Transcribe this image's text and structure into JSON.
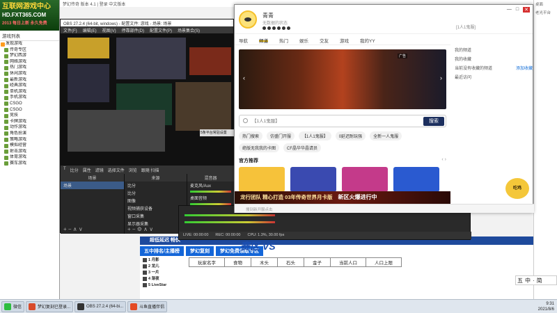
{
  "tree": {
    "logo_line1": "互联网游戏中心",
    "logo_line2": "HD.FXT365.COM",
    "logo_line3": "2013 每日上新 永久免费",
    "title": "游戏列表",
    "root": "发现游戏",
    "items": [
      "传奇专区",
      "梦幻西游",
      "网络游戏",
      "热门游戏",
      "休闲游戏",
      "最新游戏",
      "经典游戏",
      "单机游戏",
      "手机游戏",
      "CSGO",
      "CSGO",
      "竞技",
      "卡牌游戏",
      "动作游戏",
      "角色扮演",
      "策略游戏",
      "模拟经营",
      "射击游戏",
      "体育游戏",
      "赛车游戏"
    ]
  },
  "bg_window": {
    "title": "梦幻传奇 版本 4.1 | 登录 中文版本",
    "notice": "超低延迟 畅快",
    "tabs": [
      "五中排名/主播榜",
      "梦幻复刻",
      "梦幻免费领取专区"
    ],
    "table_headers": [
      "玩家名字",
      "食物",
      "木头",
      "石头",
      "金子",
      "当前人口",
      "人口上限"
    ],
    "ranks": [
      "1 月影",
      "2 龙儿",
      "3 一片",
      "4 渐夜",
      "5 LiveStar"
    ],
    "banner": "赛区 VS"
  },
  "obs": {
    "title": "OBS 27.2.4 (64-bit, windows) - 配置文件: 游戏 - 场景: 场景",
    "menu": [
      "文件(F)",
      "编辑(E)",
      "视图(V)",
      "停靠部件(D)",
      "配置文件(P)",
      "场景集合(S)",
      "工具(T)",
      "帮助(H)"
    ],
    "toolbar": [
      "T",
      "比分",
      "属性",
      "滤镜",
      "选择文件",
      "浏览",
      "跟随 扫描"
    ],
    "scenes_header": "场景",
    "scenes": [
      "场景"
    ],
    "sources_header": "来源",
    "sources": [
      "比分",
      "比分",
      "图像",
      "视频捕获设备",
      "窗口采集",
      "显示器采集"
    ],
    "mixer_header": "混音器",
    "mixer_labels": [
      "麦克风/Aux",
      "桌面音频"
    ],
    "status": [
      "LIVE: 00:00:00",
      "REC: 00:00:00",
      "CPU: 1.3%, 30.00 fps"
    ],
    "preview_caption": "5条平台常驻设置"
  },
  "yy": {
    "user_name": "青青",
    "signature": "无数据的状态",
    "channel_label": "[1人1鬼服]",
    "nav": [
      "导航",
      "频道",
      "热门",
      "娱乐",
      "交友",
      "游戏",
      "我的YY"
    ],
    "nav_active": 1,
    "carousel_ad": "广告",
    "search_placeholder": "【1人1鬼服】",
    "search_button": "搜索",
    "tags": [
      "热门搜索",
      "仿盛门开服",
      "【1人1鬼服】",
      "0延迟耐玩强",
      "全新一人鬼服",
      "绝版无我我的卡图",
      "CF晶华华晶请员"
    ],
    "rec_title": "官方推荐",
    "ad_text": "龙行团队 精心打造 03年传奇世界月卡版",
    "ad_cta": "新区火爆进行中",
    "status_text": "搜到新开服点击",
    "side_items": [
      {
        "label": "我的频道",
        "link": ""
      },
      {
        "label": "我的收藏",
        "link": ""
      },
      {
        "label": "当前没有收藏的频道",
        "link": "添加收藏"
      },
      {
        "label": "最近访问",
        "link": ""
      }
    ],
    "mascot": "吃鸡"
  },
  "wubi": [
    "五",
    "中",
    "·",
    "简"
  ],
  "right_strip": [
    "桌面",
    "老光平台"
  ],
  "taskbar": {
    "items": [
      "微信",
      "梦幻复刻已登录...",
      "OBS 27.2.4 (64-bi...",
      "斗鱼直播伴侣"
    ],
    "item_colors": [
      "#2dbd3f",
      "#d84a2a",
      "#333333",
      "#e44a24"
    ],
    "time": "9:31",
    "date": "2021/8/6"
  },
  "colors": {
    "accent": "#f6c200",
    "search_button": "#1c2f5e",
    "tab_blue": "#1466d8"
  }
}
